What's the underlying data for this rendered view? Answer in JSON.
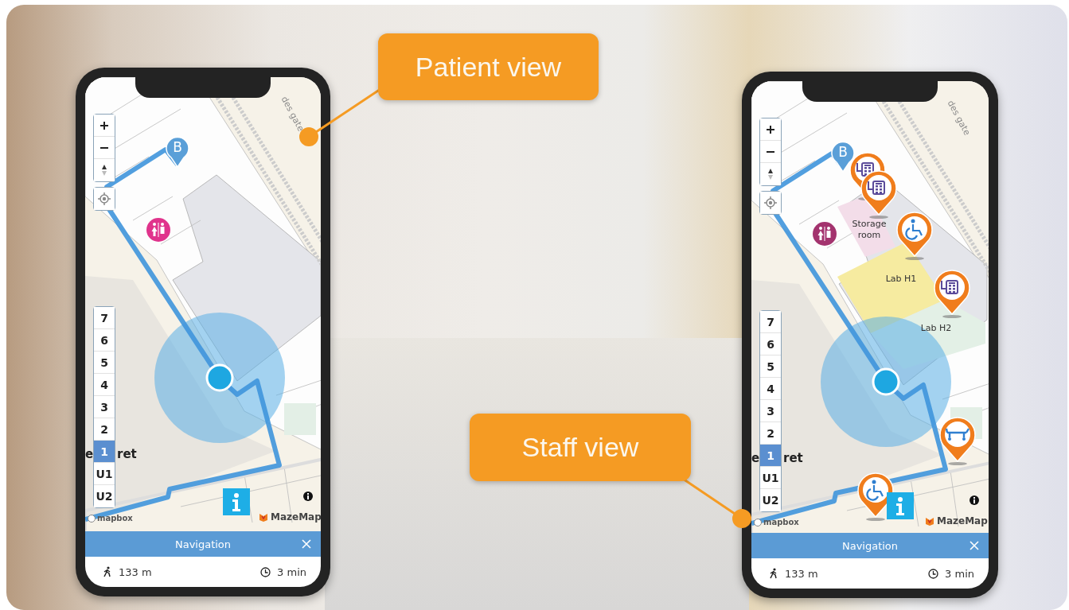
{
  "callouts": [
    {
      "label": "Patient view"
    },
    {
      "label": "Staff view"
    }
  ],
  "phones": [
    {
      "street_labels": [
        {
          "text": "des gate"
        },
        {
          "text": "e"
        },
        {
          "text": "ret"
        }
      ],
      "markers": [
        {
          "kind": "destination",
          "label": "B"
        },
        {
          "kind": "toilet"
        }
      ],
      "floors": [
        {
          "label": "7",
          "selected": false
        },
        {
          "label": "6",
          "selected": false
        },
        {
          "label": "5",
          "selected": false
        },
        {
          "label": "4",
          "selected": false
        },
        {
          "label": "3",
          "selected": false
        },
        {
          "label": "2",
          "selected": false
        },
        {
          "label": "1",
          "selected": true
        },
        {
          "label": "U1",
          "selected": false
        },
        {
          "label": "U2",
          "selected": false
        }
      ],
      "attribution": "mapbox",
      "brand": "MazeMap",
      "nav_title": "Navigation",
      "distance": "133 m",
      "duration": "3 min"
    },
    {
      "street_labels": [
        {
          "text": "des gate"
        },
        {
          "text": "e"
        },
        {
          "text": "ret"
        }
      ],
      "room_labels": [
        {
          "text": "Storage room",
          "color": "#f3dde9"
        },
        {
          "text": "Lab H1",
          "color": "#f6eba0"
        },
        {
          "text": "Lab H2",
          "color": "#e3f0e6"
        }
      ],
      "markers": [
        {
          "kind": "destination",
          "label": "B"
        },
        {
          "kind": "device"
        },
        {
          "kind": "device"
        },
        {
          "kind": "toilet"
        },
        {
          "kind": "wheelchair"
        },
        {
          "kind": "device"
        },
        {
          "kind": "bed"
        },
        {
          "kind": "wheelchair"
        }
      ],
      "floors": [
        {
          "label": "7",
          "selected": false
        },
        {
          "label": "6",
          "selected": false
        },
        {
          "label": "5",
          "selected": false
        },
        {
          "label": "4",
          "selected": false
        },
        {
          "label": "3",
          "selected": false
        },
        {
          "label": "2",
          "selected": false
        },
        {
          "label": "1",
          "selected": true
        },
        {
          "label": "U1",
          "selected": false
        },
        {
          "label": "U2",
          "selected": false
        }
      ],
      "attribution": "mapbox",
      "brand": "MazeMap",
      "nav_title": "Navigation",
      "distance": "133 m",
      "duration": "3 min"
    }
  ]
}
